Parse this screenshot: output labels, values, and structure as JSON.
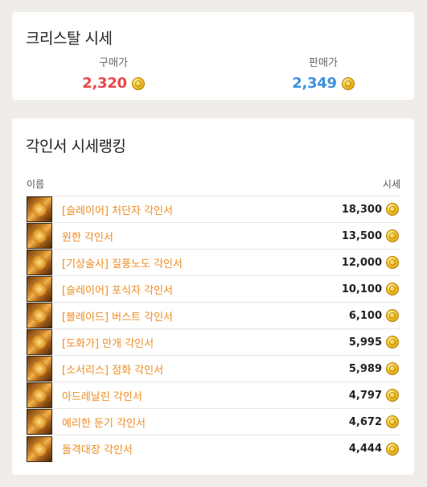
{
  "crystal": {
    "title": "크리스탈 시세",
    "buy_label": "구매가",
    "buy_price": "2,320",
    "sell_label": "판매가",
    "sell_price": "2,349",
    "buy_color": "#e8474b",
    "sell_color": "#3d8fe0",
    "currency_icon": "gold-coin-icon"
  },
  "ranking": {
    "title": "각인서 시세랭킹",
    "col_name": "이름",
    "col_price": "시세",
    "item_icon": "engraving-book-icon",
    "name_color": "#ee8c22",
    "items": [
      {
        "name": "[슬레이어] 처단자 각인서",
        "price": "18,300"
      },
      {
        "name": "원한 각인서",
        "price": "13,500"
      },
      {
        "name": "[기상술사] 질풍노도 각인서",
        "price": "12,000"
      },
      {
        "name": "[슬레이어] 포식자 각인서",
        "price": "10,100"
      },
      {
        "name": "[블레이드] 버스트 각인서",
        "price": "6,100"
      },
      {
        "name": "[도화가] 만개 각인서",
        "price": "5,995"
      },
      {
        "name": "[소서리스] 점화 각인서",
        "price": "5,989"
      },
      {
        "name": "아드레날린 각인서",
        "price": "4,797"
      },
      {
        "name": "예리한 둔기 각인서",
        "price": "4,672"
      },
      {
        "name": "돌격대장 각인서",
        "price": "4,444"
      }
    ]
  }
}
